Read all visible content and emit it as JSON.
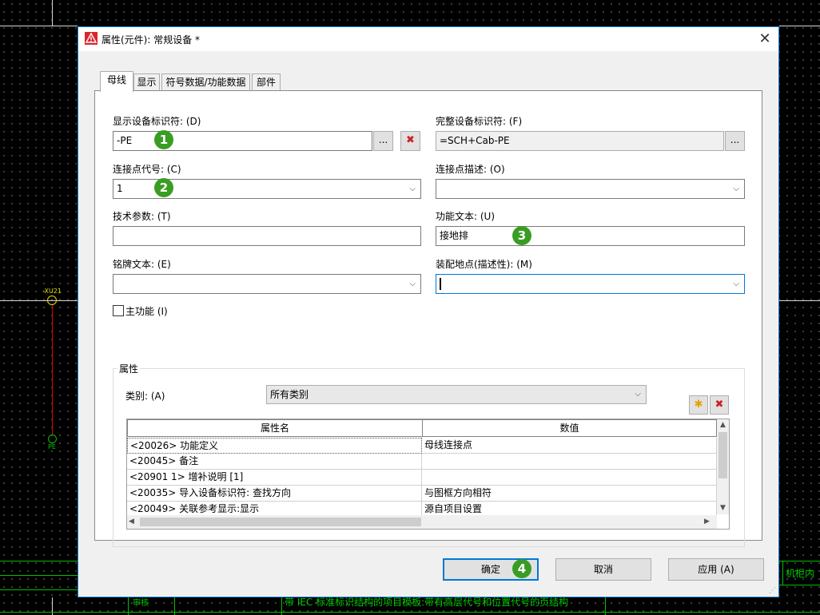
{
  "window": {
    "title": "属性(元件): 常规设备 *"
  },
  "tabs": [
    "母线",
    "显示",
    "符号数据/功能数据",
    "部件"
  ],
  "fields": {
    "display_dt": {
      "label": "显示设备标识符: (D)",
      "value": "-PE",
      "badge": "1"
    },
    "full_dt": {
      "label": "完整设备标识符: (F)",
      "value": "=SCH+Cab-PE"
    },
    "conn_designation": {
      "label": "连接点代号: (C)",
      "value": "1",
      "badge": "2"
    },
    "conn_description": {
      "label": "连接点描述: (O)",
      "value": ""
    },
    "tech_params": {
      "label": "技术参数: (T)",
      "value": ""
    },
    "function_text": {
      "label": "功能文本: (U)",
      "value": "接地排",
      "badge": "3"
    },
    "nameplate_text": {
      "label": "铭牌文本: (E)",
      "value": ""
    },
    "mounting_location": {
      "label": "装配地点(描述性): (M)",
      "value": ""
    }
  },
  "main_function": {
    "label": "主功能 (I)",
    "checked": false
  },
  "properties": {
    "group_title": "属性",
    "category_label": "类别: (A)",
    "category_value": "所有类别",
    "columns": [
      "属性名",
      "数值"
    ],
    "rows": [
      [
        "<20026> 功能定义",
        "母线连接点"
      ],
      [
        "<20045> 备注",
        ""
      ],
      [
        "<20901 1> 增补说明 [1]",
        ""
      ],
      [
        "<20035> 导入设备标识符: 查找方向",
        "与图框方向相符"
      ],
      [
        "<20049> 关联参考显示:显示",
        "源自项目设置"
      ]
    ]
  },
  "buttons": {
    "ok": "确定",
    "ok_badge": "4",
    "cancel": "取消",
    "apply": "应用 (A)"
  },
  "icons": {
    "browse": "...",
    "delete": "✖",
    "new": "✱",
    "chevron": "⌵"
  },
  "background": {
    "label_x1": "-XU21",
    "label_pe": "PE",
    "right_text": "机柜内",
    "bottom_left": "审核",
    "bottom_text": "带 IEC 标准标识结构的项目模板:带有高层代号和位置代号的页结构"
  },
  "colors": {
    "accent": "#0078d7",
    "badge": "#3a9d23",
    "delete": "#cc2222",
    "cad_green": "#00c000"
  }
}
